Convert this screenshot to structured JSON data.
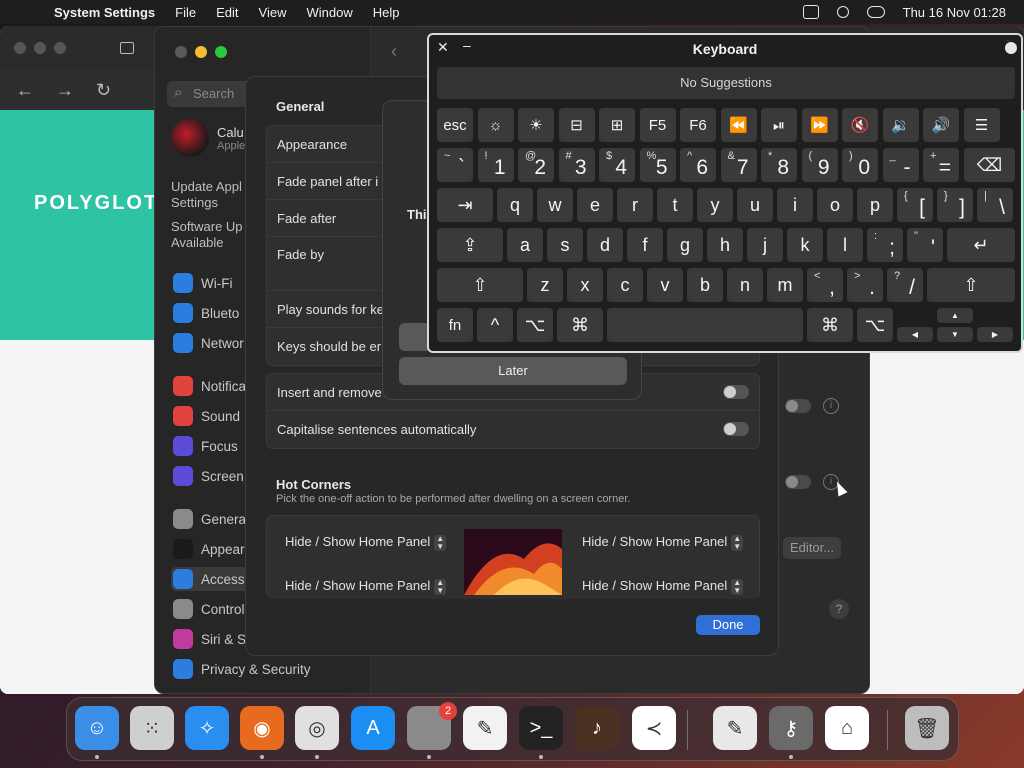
{
  "menubar": {
    "app_name": "System Settings",
    "menus": [
      "File",
      "Edit",
      "View",
      "Window",
      "Help"
    ],
    "datetime": "Thu 16 Nov  01:28"
  },
  "browser": {
    "hero_title": "POLYGLOT"
  },
  "settings": {
    "search_placeholder": "Search",
    "user_name": "Calu",
    "user_sub": "Apple",
    "update_line1": "Update Appl",
    "update_line2": "Settings",
    "software_line1": "Software Up",
    "software_line2": "Available",
    "items": [
      {
        "label": "Wi-Fi",
        "icon": "wifi-icon",
        "color": "#2b7de0"
      },
      {
        "label": "Blueto",
        "icon": "bluetooth-icon",
        "color": "#2b7de0"
      },
      {
        "label": "Networ",
        "icon": "network-icon",
        "color": "#2b7de0"
      },
      {
        "label": "Notifica",
        "icon": "notifications-icon",
        "color": "#e0443c"
      },
      {
        "label": "Sound",
        "icon": "sound-icon",
        "color": "#e0443c"
      },
      {
        "label": "Focus",
        "icon": "focus-icon",
        "color": "#5b4bd6"
      },
      {
        "label": "Screen T",
        "icon": "screen-time-icon",
        "color": "#5b4bd6"
      },
      {
        "label": "General",
        "icon": "general-icon",
        "color": "#8a8a8a"
      },
      {
        "label": "Appeara",
        "icon": "appearance-icon",
        "color": "#1a1a1a"
      },
      {
        "label": "Accessi",
        "icon": "accessibility-icon",
        "color": "#2b7de0"
      },
      {
        "label": "Control",
        "icon": "control-centre-icon",
        "color": "#8a8a8a"
      },
      {
        "label": "Siri & Sp",
        "icon": "siri-icon",
        "color": "#c03aa0"
      },
      {
        "label": "Privacy & Security",
        "icon": "privacy-icon",
        "color": "#2b7de0"
      }
    ],
    "editor_label": "Editor...",
    "help_label": "?"
  },
  "sheet": {
    "heading": "General",
    "rows": [
      "Appearance",
      "Fade panel after i",
      "Fade after",
      "Fade by"
    ],
    "rows2": [
      "Play sounds for ke",
      "Keys should be er"
    ],
    "toggle_rows": [
      "Insert and remove",
      "Capitalise sentences automatically"
    ],
    "hot_corners_title": "Hot Corners",
    "hot_corners_sub": "Pick the one-off action to be performed after dwelling on a screen corner.",
    "corner_tl": "Hide / Show Home Panel",
    "corner_tr": "Hide / Show Home Panel",
    "corner_bl": "Hide / Show Home Panel",
    "corner_br": "Hide / Show Home Panel",
    "done_label": "Done"
  },
  "alert": {
    "message": "Thi",
    "later_label": "Later"
  },
  "keyboard": {
    "title": "Keyboard",
    "suggestions": "No Suggestions",
    "fn_row": [
      "esc",
      "☼",
      "☀",
      "⊟",
      "⊞",
      "F5",
      "F6",
      "⏪",
      "⏯",
      "⏩",
      "🔇",
      "🔉",
      "🔊",
      "☰"
    ],
    "num_row": [
      [
        "~",
        "`"
      ],
      [
        "!",
        "1"
      ],
      [
        "@",
        "2"
      ],
      [
        "#",
        "3"
      ],
      [
        "$",
        "4"
      ],
      [
        "%",
        "5"
      ],
      [
        "^",
        "6"
      ],
      [
        "&",
        "7"
      ],
      [
        "*",
        "8"
      ],
      [
        "(",
        "9"
      ],
      [
        ")",
        "0"
      ],
      [
        "_",
        "-"
      ],
      [
        "+",
        "="
      ]
    ],
    "delete_key": "⌫",
    "tab_key": "⇥",
    "row_q": [
      "q",
      "w",
      "e",
      "r",
      "t",
      "y",
      "u",
      "i",
      "o",
      "p"
    ],
    "row_q_sym": [
      [
        "{",
        "["
      ],
      [
        "}",
        "]"
      ],
      [
        "|",
        "\\"
      ]
    ],
    "caps_key": "⇪",
    "row_a": [
      "a",
      "s",
      "d",
      "f",
      "g",
      "h",
      "j",
      "k",
      "l"
    ],
    "row_a_sym": [
      [
        ":",
        ";"
      ],
      [
        "\"",
        "'"
      ]
    ],
    "return_key": "↵",
    "shift_key": "⇧",
    "row_z": [
      "z",
      "x",
      "c",
      "v",
      "b",
      "n",
      "m"
    ],
    "row_z_sym": [
      [
        "<",
        ","
      ],
      [
        ">",
        "."
      ],
      [
        "?",
        "/"
      ]
    ],
    "fn_key": "fn",
    "ctrl_key": "^",
    "opt_key": "⌥",
    "cmd_key": "⌘",
    "arrow_up": "▲",
    "arrow_left": "◀",
    "arrow_down": "▼",
    "arrow_right": "▶"
  },
  "dock": {
    "apps": [
      {
        "name": "finder-icon",
        "color": "#3a8ee6",
        "glyph": "☺"
      },
      {
        "name": "launchpad-icon",
        "color": "#cfcfcf",
        "glyph": "⁙"
      },
      {
        "name": "safari-icon",
        "color": "#2a8ef0",
        "glyph": "✧"
      },
      {
        "name": "firefox-icon",
        "color": "#e86a1f",
        "glyph": "◉"
      },
      {
        "name": "chrome-icon",
        "color": "#e0e0e0",
        "glyph": "◎"
      },
      {
        "name": "app-store-icon",
        "color": "#1b8ef3",
        "glyph": "A"
      },
      {
        "name": "system-settings-icon",
        "color": "#8a8a8a",
        "glyph": "⚙"
      },
      {
        "name": "textedit-icon",
        "color": "#f2f2f2",
        "glyph": "✎"
      },
      {
        "name": "terminal-icon",
        "color": "#222222",
        "glyph": ">_"
      },
      {
        "name": "garageband-icon",
        "color": "#4a3020",
        "glyph": "♪"
      },
      {
        "name": "vscode-icon",
        "color": "#ffffff",
        "glyph": "≺"
      },
      {
        "name": "script-editor-icon",
        "color": "#e8e8e8",
        "glyph": "✎"
      },
      {
        "name": "keychain-icon",
        "color": "#6a6a6a",
        "glyph": "⚷"
      },
      {
        "name": "home-icon",
        "color": "#ffffff",
        "glyph": "⌂"
      },
      {
        "name": "trash-icon",
        "color": "#bdbdbd",
        "glyph": "🗑"
      }
    ],
    "settings_badge": "2"
  }
}
